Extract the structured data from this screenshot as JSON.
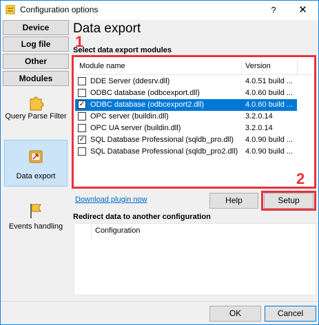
{
  "window": {
    "title": "Configuration options",
    "help_label": "?",
    "close_label": "✕"
  },
  "nav": {
    "device": "Device",
    "log_file": "Log file",
    "other": "Other",
    "modules": "Modules"
  },
  "modules": [
    {
      "label": "Query Parse Filter",
      "icon": "puzzle-icon"
    },
    {
      "label": "Data export",
      "icon": "export-icon",
      "selected": true
    },
    {
      "label": "Events handling",
      "icon": "flag-icon"
    }
  ],
  "main": {
    "title": "Data export",
    "select_label": "Select data export modules",
    "columns": {
      "name": "Module name",
      "version": "Version"
    },
    "rows": [
      {
        "name": "DDE Server (ddesrv.dll)",
        "version": "4.0.51 build ...",
        "checked": false,
        "selected": false
      },
      {
        "name": "ODBC database (odbcexport.dll)",
        "version": "4.0.60 build ...",
        "checked": false,
        "selected": false
      },
      {
        "name": "ODBC database (odbcexport2.dll)",
        "version": "4.0.60 build ...",
        "checked": true,
        "selected": true
      },
      {
        "name": "OPC server (buildin.dll)",
        "version": "3.2.0.14",
        "checked": false,
        "selected": false
      },
      {
        "name": "OPC UA server (buildin.dll)",
        "version": "3.2.0.14",
        "checked": false,
        "selected": false
      },
      {
        "name": "SQL Database Professional (sqldb_pro.dll)",
        "version": "4.0.90 build ...",
        "checked": true,
        "selected": false
      },
      {
        "name": "SQL Database Professional (sqldb_pro2.dll)",
        "version": "4.0.90 build ...",
        "checked": false,
        "selected": false
      }
    ],
    "badge_1": "1",
    "badge_2": "2",
    "download_link": "Download plugin now",
    "help_button": "Help",
    "setup_button": "Setup",
    "redirect_label": "Redirect data to another configuration",
    "redirect_column": "Configuration"
  },
  "footer": {
    "ok": "OK",
    "cancel": "Cancel"
  },
  "colors": {
    "accent": "#0078d7",
    "highlight_frame": "#e8333b",
    "link": "#0066cc"
  }
}
